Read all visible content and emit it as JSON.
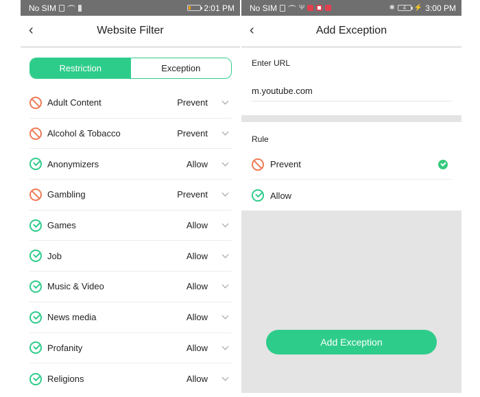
{
  "left": {
    "status_bar": {
      "carrier": "No SIM",
      "time": "2:01 PM"
    },
    "header": {
      "back_icon": "chevron-left-icon",
      "title": "Website Filter"
    },
    "tabs": [
      {
        "label": "Restriction",
        "active": true
      },
      {
        "label": "Exception",
        "active": false
      }
    ],
    "categories": [
      {
        "name": "Adult Content",
        "status": "Prevent",
        "icon": "prevent-icon"
      },
      {
        "name": "Alcohol & Tobacco",
        "status": "Prevent",
        "icon": "prevent-icon"
      },
      {
        "name": "Anonymizers",
        "status": "Allow",
        "icon": "allow-icon"
      },
      {
        "name": "Gambling",
        "status": "Prevent",
        "icon": "prevent-icon"
      },
      {
        "name": "Games",
        "status": "Allow",
        "icon": "allow-icon"
      },
      {
        "name": "Job",
        "status": "Allow",
        "icon": "allow-icon"
      },
      {
        "name": "Music & Video",
        "status": "Allow",
        "icon": "allow-icon"
      },
      {
        "name": "News media",
        "status": "Allow",
        "icon": "allow-icon"
      },
      {
        "name": "Profanity",
        "status": "Allow",
        "icon": "allow-icon"
      },
      {
        "name": "Religions",
        "status": "Allow",
        "icon": "allow-icon"
      }
    ]
  },
  "right": {
    "status_bar": {
      "carrier": "No SIM",
      "battery": "4",
      "time": "3:00 PM"
    },
    "header": {
      "back_icon": "chevron-left-icon",
      "title": "Add Exception"
    },
    "url_label": "Enter URL",
    "url_value": "m.youtube.com",
    "rule_label": "Rule",
    "rules": [
      {
        "name": "Prevent",
        "selected": true
      },
      {
        "name": "Allow",
        "selected": false
      }
    ],
    "submit_label": "Add Exception"
  },
  "colors": {
    "accent": "#2ecc8a",
    "prevent": "#f07a55",
    "status_bar": "#6f6f6f"
  }
}
